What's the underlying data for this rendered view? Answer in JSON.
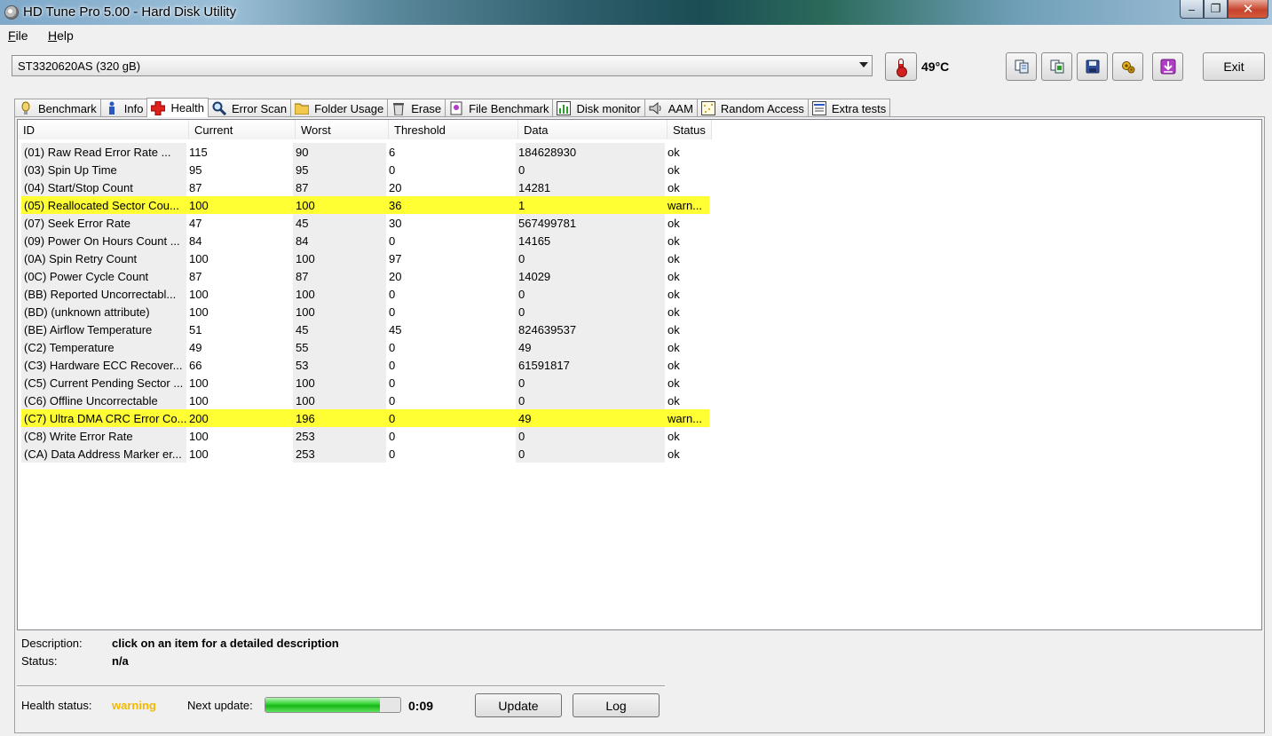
{
  "window": {
    "title": "HD Tune Pro 5.00 - Hard Disk Utility",
    "minimize": "–",
    "maximize": "❐",
    "close": "✕"
  },
  "menu": [
    {
      "ul": "F",
      "rest": "ile"
    },
    {
      "ul": "H",
      "rest": "elp"
    }
  ],
  "toolbar": {
    "drive": "ST3320620AS (320 gB)",
    "temperature": "49°C",
    "exit_label": "Exit",
    "icons": [
      "copy-info-icon",
      "copy-all-icon",
      "save-icon",
      "options-icon",
      "download-icon"
    ]
  },
  "tabs": [
    {
      "label": "Benchmark",
      "icon": "benchmark-icon"
    },
    {
      "label": "Info",
      "icon": "info-icon"
    },
    {
      "label": "Health",
      "icon": "health-icon",
      "active": true
    },
    {
      "label": "Error Scan",
      "icon": "error-scan-icon"
    },
    {
      "label": "Folder Usage",
      "icon": "folder-icon"
    },
    {
      "label": "Erase",
      "icon": "erase-icon"
    },
    {
      "label": "File Benchmark",
      "icon": "file-benchmark-icon"
    },
    {
      "label": "Disk monitor",
      "icon": "disk-monitor-icon"
    },
    {
      "label": "AAM",
      "icon": "aam-icon"
    },
    {
      "label": "Random Access",
      "icon": "random-access-icon"
    },
    {
      "label": "Extra tests",
      "icon": "extra-tests-icon"
    }
  ],
  "table": {
    "columns": [
      "ID",
      "Current",
      "Worst",
      "Threshold",
      "Data",
      "Status"
    ],
    "rows": [
      [
        "(01) Raw Read Error Rate    ...",
        "115",
        "90",
        "6",
        "184628930",
        "ok"
      ],
      [
        "(03) Spin Up Time",
        "95",
        "95",
        "0",
        "0",
        "ok"
      ],
      [
        "(04) Start/Stop Count",
        "87",
        "87",
        "20",
        "14281",
        "ok"
      ],
      [
        "(05) Reallocated Sector Cou...",
        "100",
        "100",
        "36",
        "1",
        "warn..."
      ],
      [
        "(07) Seek Error Rate",
        "47",
        "45",
        "30",
        "567499781",
        "ok"
      ],
      [
        "(09) Power On Hours Count   ...",
        "84",
        "84",
        "0",
        "14165",
        "ok"
      ],
      [
        "(0A) Spin Retry Count",
        "100",
        "100",
        "97",
        "0",
        "ok"
      ],
      [
        "(0C) Power Cycle Count",
        "87",
        "87",
        "20",
        "14029",
        "ok"
      ],
      [
        "(BB) Reported Uncorrectabl...",
        "100",
        "100",
        "0",
        "0",
        "ok"
      ],
      [
        "(BD) (unknown attribute)",
        "100",
        "100",
        "0",
        "0",
        "ok"
      ],
      [
        "(BE) Airflow Temperature",
        "51",
        "45",
        "45",
        "824639537",
        "ok"
      ],
      [
        "(C2) Temperature",
        "49",
        "55",
        "0",
        "49",
        "ok"
      ],
      [
        "(C3) Hardware ECC Recover...",
        "66",
        "53",
        "0",
        "61591817",
        "ok"
      ],
      [
        "(C5) Current Pending Sector  ...",
        "100",
        "100",
        "0",
        "0",
        "ok"
      ],
      [
        "(C6) Offline Uncorrectable",
        "100",
        "100",
        "0",
        "0",
        "ok"
      ],
      [
        "(C7) Ultra DMA CRC Error Co...",
        "200",
        "196",
        "0",
        "49",
        "warn..."
      ],
      [
        "(C8) Write Error Rate",
        "100",
        "253",
        "0",
        "0",
        "ok"
      ],
      [
        "(CA) Data Address Marker er...",
        "100",
        "253",
        "0",
        "0",
        "ok"
      ]
    ],
    "warn_rows": [
      3,
      15
    ],
    "warn_color": "#ffff33"
  },
  "details": {
    "description_label": "Description:",
    "description_value": "click on an item for a detailed description",
    "status_label": "Status:",
    "status_value": "n/a"
  },
  "footer": {
    "health_label": "Health status:",
    "health_value": "warning",
    "health_color": "#f5b800",
    "next_update_label": "Next update:",
    "progress_fraction": 0.85,
    "countdown": "0:09",
    "update_label": "Update",
    "log_label": "Log"
  }
}
